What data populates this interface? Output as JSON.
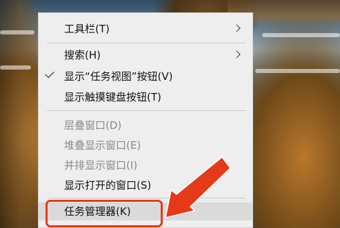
{
  "context_menu": {
    "items": [
      {
        "label": "工具栏(T)",
        "submenu": true
      },
      {
        "label": "搜索(H)",
        "submenu": true
      },
      {
        "label": "显示“任务视图”按钮(V)",
        "checked": true
      },
      {
        "label": "显示触摸键盘按钮(T)"
      },
      {
        "label": "层叠窗口(D)",
        "disabled": true
      },
      {
        "label": "堆叠显示窗口(E)",
        "disabled": true
      },
      {
        "label": "并排显示窗口(I)",
        "disabled": true
      },
      {
        "label": "显示打开的窗口(S)"
      },
      {
        "label": "任务管理器(K)",
        "hovered": true
      }
    ]
  },
  "annotation": {
    "color": "#e53a17",
    "icon": "red-pointer-arrow"
  }
}
